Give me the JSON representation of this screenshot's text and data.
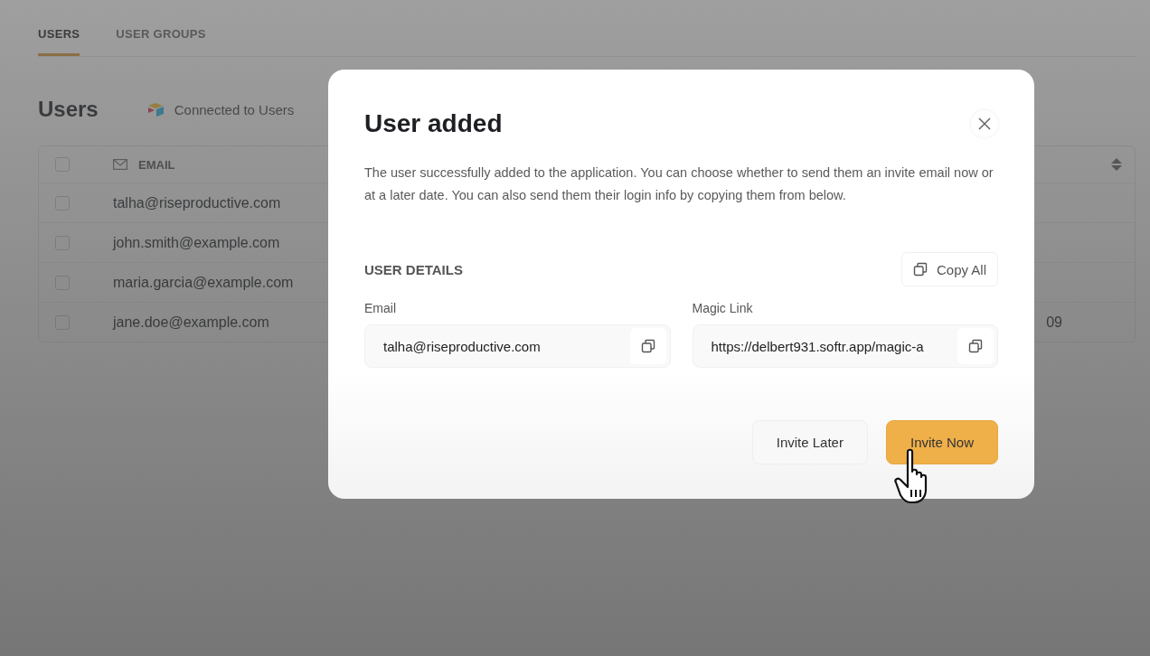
{
  "tabs": [
    {
      "label": "USERS",
      "selected": true
    },
    {
      "label": "USER GROUPS",
      "selected": false
    }
  ],
  "page_title": "Users",
  "connection": "Connected to Users",
  "table": {
    "select_all_checked": false,
    "columns": [
      {
        "label": "EMAIL"
      }
    ],
    "rows": [
      {
        "checked": false,
        "email": "talha@riseproductive.com"
      },
      {
        "checked": false,
        "email": "john.smith@example.com"
      },
      {
        "checked": false,
        "email": "maria.garcia@example.com"
      },
      {
        "checked": false,
        "email": "jane.doe@example.com",
        "column_3": "09"
      }
    ]
  },
  "dialog": {
    "title": "User added",
    "description": "The user successfully added to the application. You can choose whether to send them an invite email now or at a later date. You can also send them their login info by copying them from below.",
    "section_title": "USER DETAILS",
    "copy_all": "Copy All",
    "fields": [
      {
        "label": "Email",
        "value": "talha@riseproductive.com"
      },
      {
        "label": "Magic Link",
        "value": "https://delbert931.softr.app/magic-a"
      }
    ],
    "buttons": [
      {
        "label": "Invite Later",
        "kind": "secondary"
      },
      {
        "label": "Invite Now",
        "kind": "primary"
      }
    ]
  }
}
